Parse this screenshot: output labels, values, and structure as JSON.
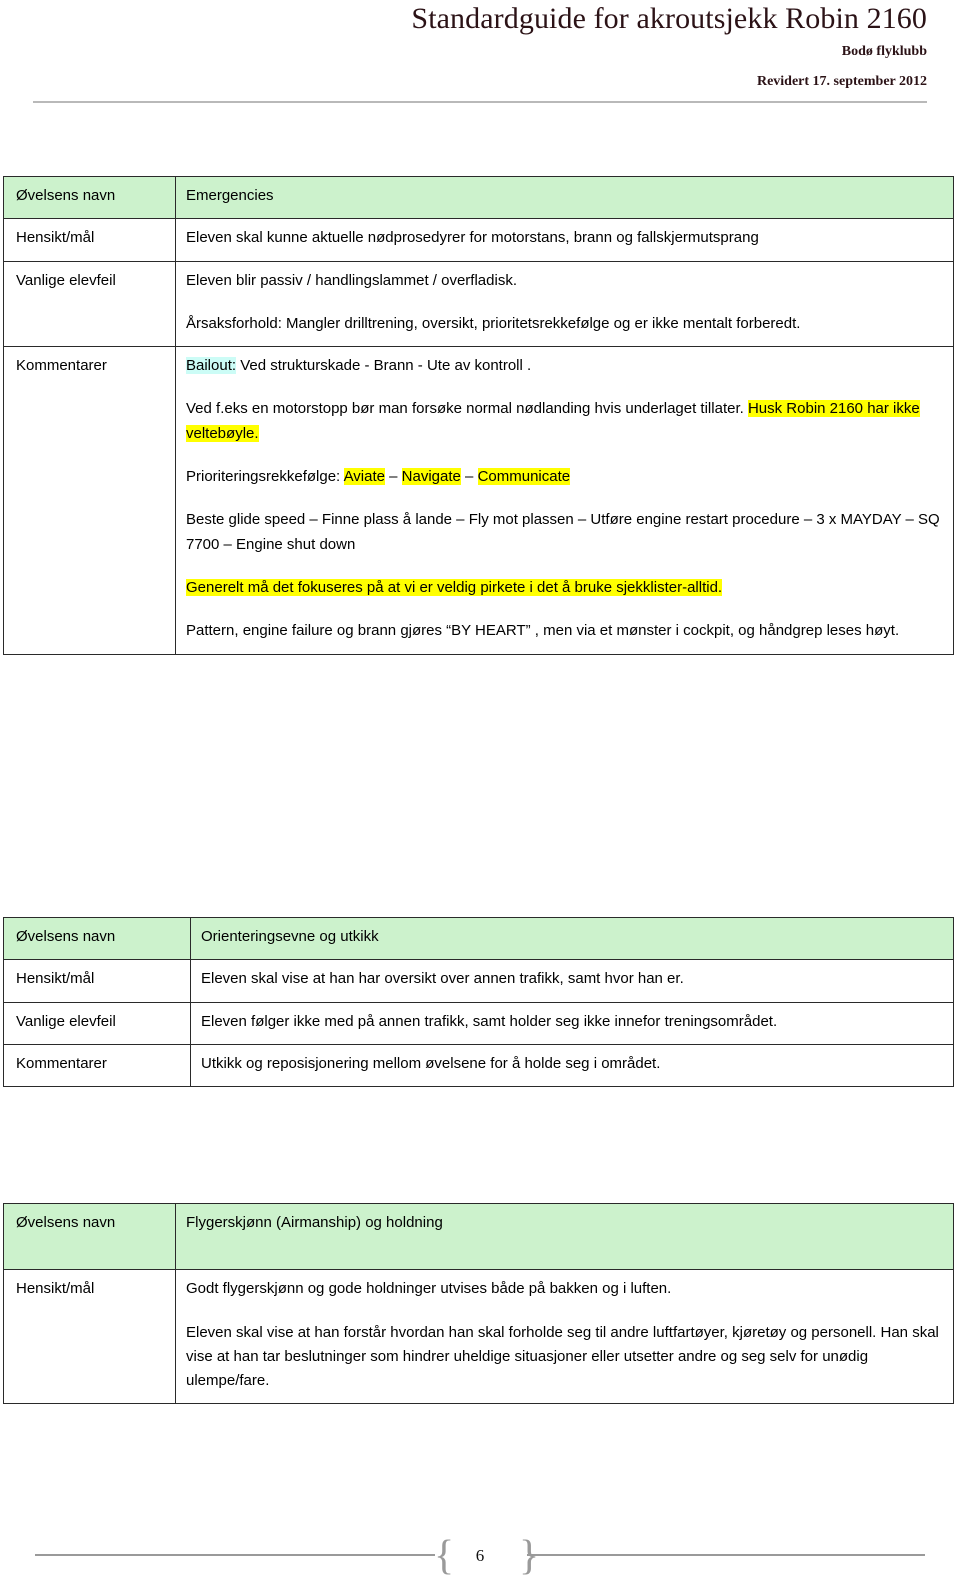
{
  "header": {
    "title": "Standardguide for akroutsjekk Robin 2160",
    "club": "Bodø flyklubb",
    "revision": "Revidert 17. september 2012"
  },
  "labels": {
    "ovelsens_navn": "Øvelsens navn",
    "hensikt_mal": "Hensikt/mål",
    "vanlige_elevfeil": "Vanlige elevfeil",
    "kommentarer": "Kommentarer"
  },
  "tables": [
    {
      "id": "emergencies",
      "name": "Emergencies",
      "hensikt": "Eleven skal kunne aktuelle nødprosedyrer for motorstans, brann og fallskjermutsprang",
      "elevfeil_1": "Eleven blir passiv / handlingslammet / overfladisk.",
      "elevfeil_2": "Årsaksforhold: Mangler drilltrening, oversikt, prioritetsrekkefølge og er ikke mentalt forberedt.",
      "kommentarer": {
        "p1_highlight": "Bailout:",
        "p1_rest": " Ved strukturskade - Brann - Ute av kontroll .",
        "p2_pre": "Ved  f.eks en motorstopp bør man forsøke normal nødlanding hvis underlaget tillater. ",
        "p2_highlight": "Husk Robin 2160 har ikke veltebøyle.",
        "p3_pre": "Prioriteringsrekkefølge: ",
        "p3_hl1": "Aviate",
        "p3_sep1": " – ",
        "p3_hl2": "Navigate",
        "p3_sep2": " – ",
        "p3_hl3": "Communicate",
        "p4": "Beste glide speed – Finne plass å lande – Fly mot plassen – Utføre engine restart procedure – 3 x MAYDAY – SQ 7700 – Engine shut down",
        "p5_highlight": "Generelt må det fokuseres på at vi er veldig pirkete i det å bruke sjekklister-alltid.",
        "p6": "Pattern, engine failure og brann gjøres “BY HEART” , men via et mønster i cockpit, og håndgrep leses høyt."
      }
    },
    {
      "id": "orientering",
      "name": "Orienteringsevne og utkikk",
      "hensikt": "Eleven skal vise at han har oversikt over annen trafikk, samt hvor han er.",
      "elevfeil": "Eleven følger ikke med på annen trafikk, samt holder seg ikke innefor treningsområdet.",
      "kommentarer": "Utkikk og reposisjonering mellom øvelsene for å holde seg i området."
    },
    {
      "id": "airmanship",
      "name": "Flygerskjønn (Airmanship) og holdning",
      "hensikt_1": "Godt flygerskjønn og gode holdninger utvises både på bakken og i luften.",
      "hensikt_2": "Eleven skal vise at han forstår hvordan han skal forholde seg til andre luftfartøyer, kjøretøy og personell.  Han skal vise at han tar beslutninger som hindrer uheldige situasjoner eller utsetter andre og seg selv for unødig ulempe/fare."
    }
  ],
  "footer": {
    "page_number": "6",
    "brace_left": "{",
    "brace_right": "}"
  },
  "colors": {
    "header_green": "#ccf2cc",
    "highlight_yellow": "#ffff00",
    "highlight_cyan": "#ccfcf6",
    "title_color": "#2b1216",
    "rule_gray": "#b9b9b9"
  }
}
